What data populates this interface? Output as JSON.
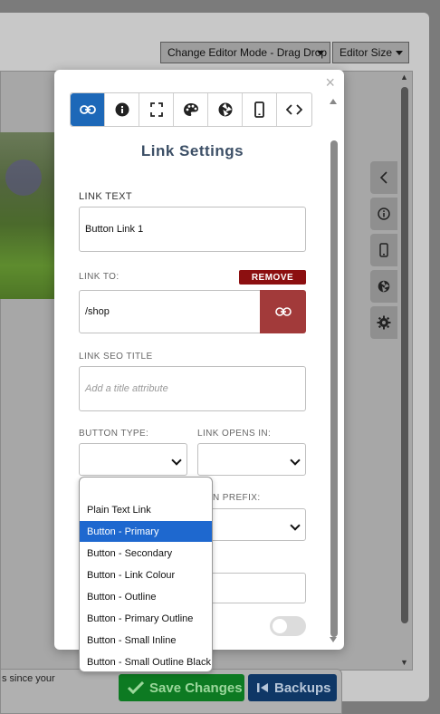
{
  "toolbar": {
    "editor_mode": "Change Editor Mode - Drag Drop",
    "editor_size": "Editor Size"
  },
  "footer": {
    "notice": "s since your",
    "save_label": "Save Changes",
    "backups_label": "Backups"
  },
  "modal": {
    "close_glyph": "×",
    "title": "Link Settings",
    "link_text": {
      "label": "LINK TEXT",
      "value": "Button Link 1"
    },
    "link_to": {
      "label": "LINK TO:",
      "remove_label": "REMOVE",
      "value": "/shop"
    },
    "seo_title": {
      "label": "LINK SEO TITLE",
      "placeholder": "Add a title attribute"
    },
    "button_type": {
      "label": "BUTTON TYPE:",
      "value": ""
    },
    "link_opens_in": {
      "label": "LINK OPENS IN:",
      "value": ""
    },
    "prefix": {
      "label": "N PREFIX:"
    }
  },
  "dropdown": {
    "options": [
      "",
      "Plain Text Link",
      "Button - Primary",
      "Button - Secondary",
      "Button - Link Colour",
      "Button - Outline",
      "Button - Primary Outline",
      "Button - Small Inline",
      "Button - Small Outline Black"
    ],
    "selected": "Button - Primary"
  },
  "colors": {
    "active_tab": "#1d68b8",
    "remove_button": "#8c0f10",
    "link_button": "#a23a3a",
    "save_button": "#0d7a22",
    "backups_button": "#0f3766",
    "dropdown_highlight": "#1e68cf"
  }
}
